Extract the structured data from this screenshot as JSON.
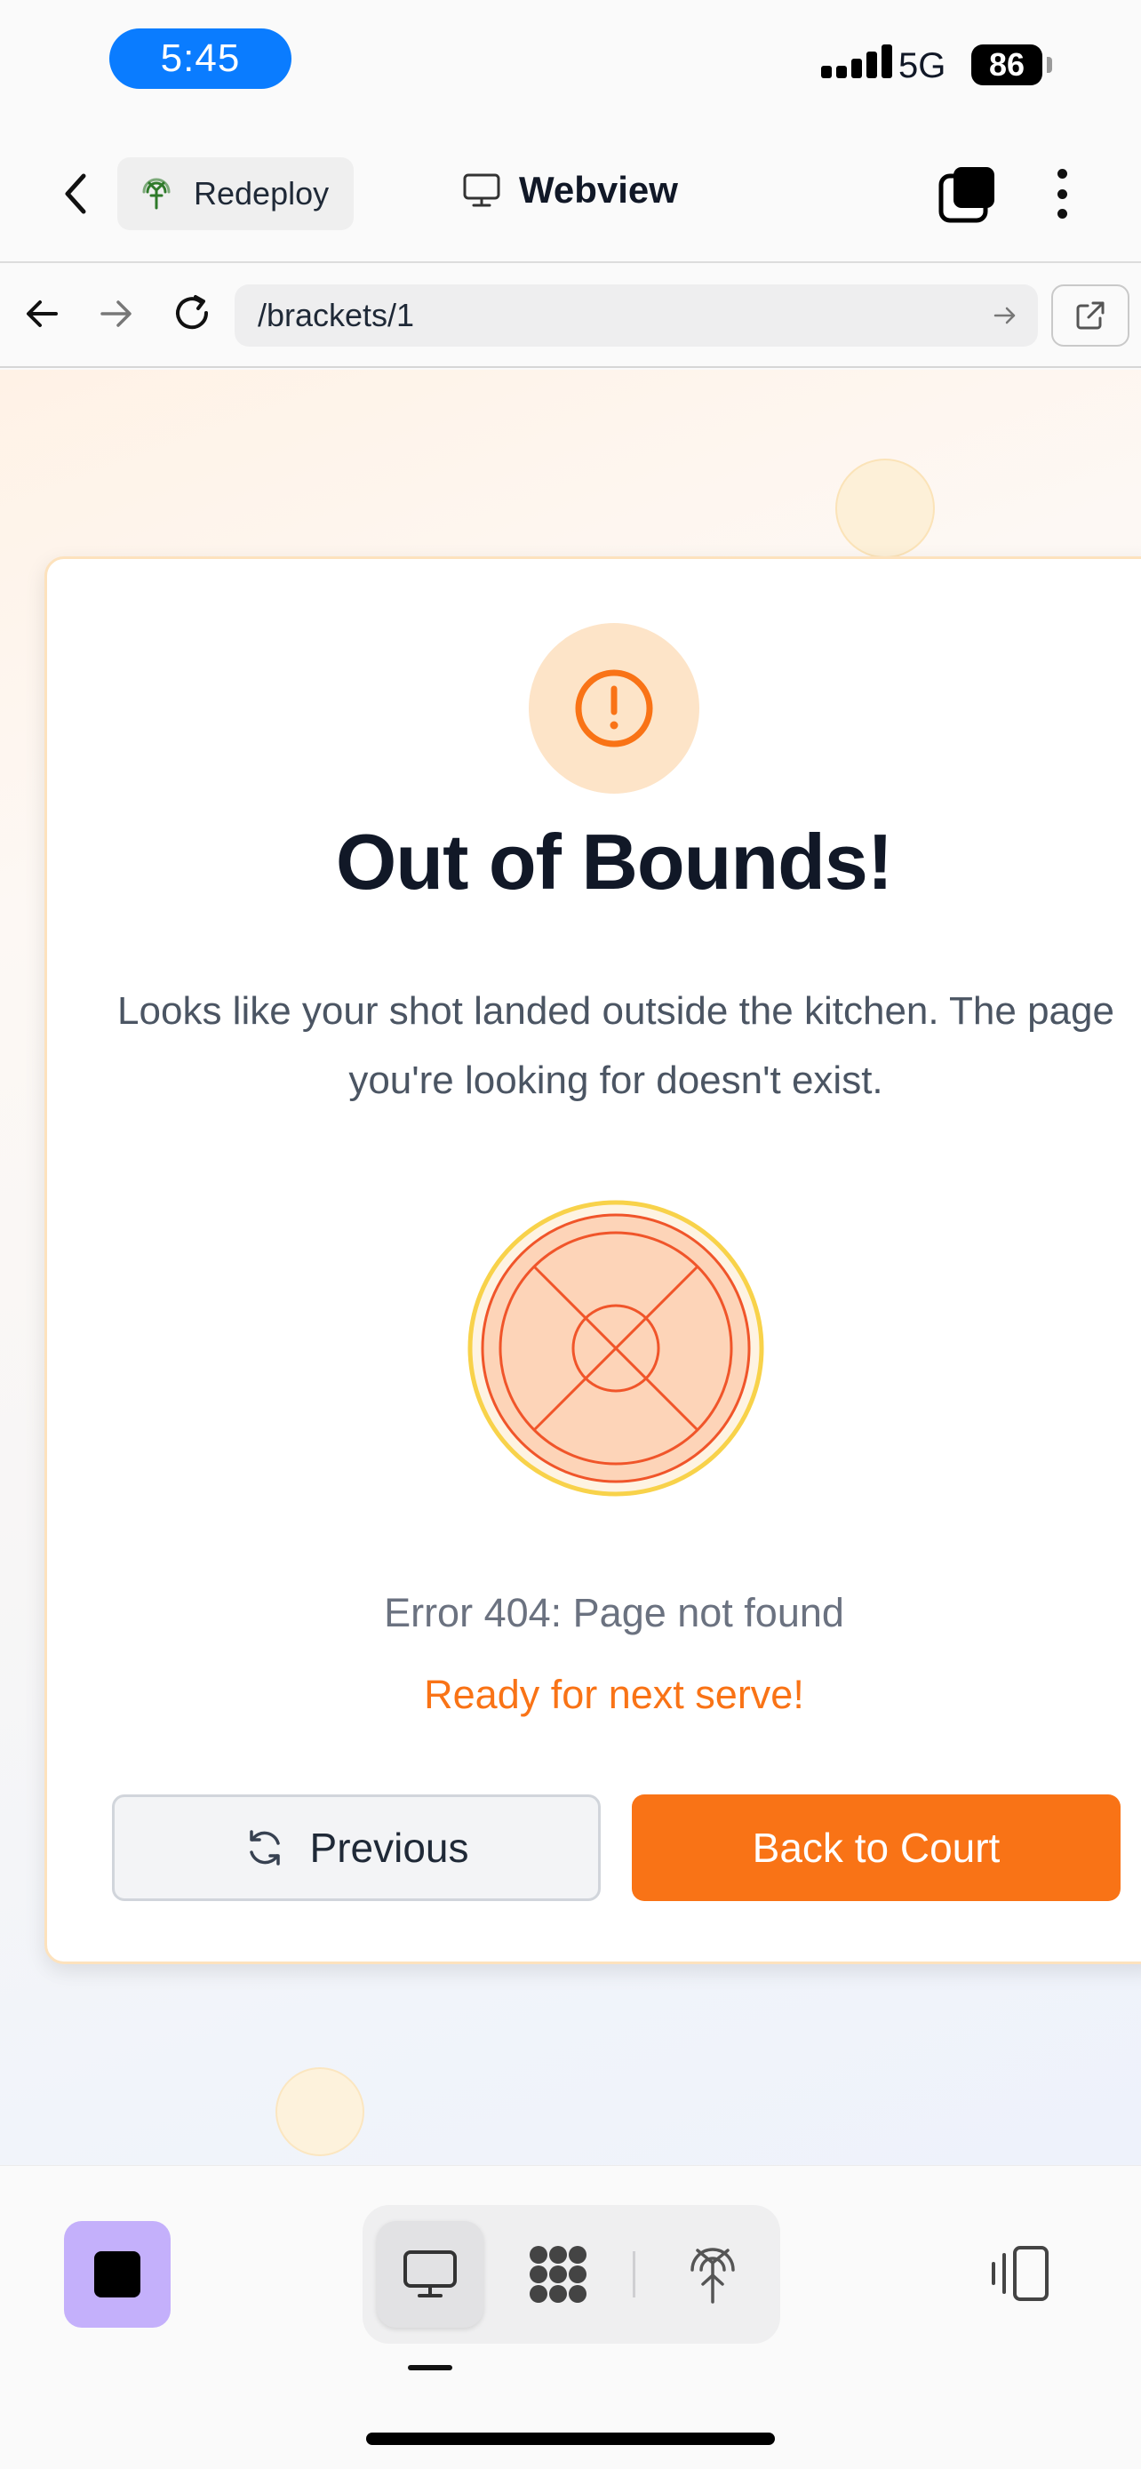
{
  "status_bar": {
    "time": "5:45",
    "network": "5G",
    "battery": "86"
  },
  "header": {
    "redeploy_label": "Redeploy",
    "title": "Webview"
  },
  "urlbar": {
    "url": "/brackets/1"
  },
  "page": {
    "error_title": "Out of Bounds!",
    "error_description": "Looks like your shot landed outside the kitchen. The page you're looking for doesn't exist.",
    "error_code": "Error 404: Page not found",
    "tagline": "Ready for next serve!",
    "previous_label": "Previous",
    "back_label": "Back to Court"
  },
  "colors": {
    "accent": "#f97316",
    "status_pill": "#0a7cff",
    "stop_button": "#c4b0fb"
  },
  "icons": {
    "back": "chevron-left-icon",
    "redeploy": "antenna-icon",
    "webview": "monitor-icon",
    "tabs": "stacked-squares-icon",
    "more": "more-vertical-icon",
    "nav_back": "arrow-left-icon",
    "nav_forward": "arrow-right-icon",
    "reload": "reload-icon",
    "go": "arrow-right-icon",
    "open_external": "external-link-icon",
    "alert": "alert-circle-icon",
    "ball": "pickleball-icon",
    "refresh": "refresh-icon",
    "stop": "stop-icon",
    "desktop": "monitor-icon",
    "grid": "app-grid-icon",
    "deploy": "antenna-icon",
    "panel": "side-panel-icon"
  }
}
